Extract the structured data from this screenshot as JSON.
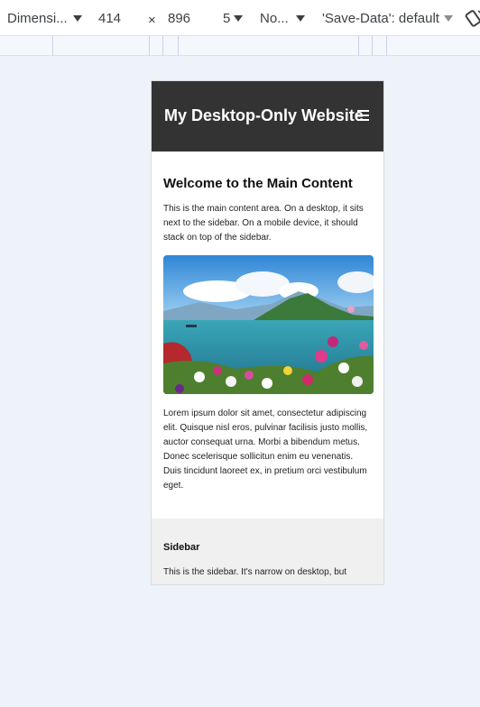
{
  "toolbar": {
    "dimensions_label": "Dimensi...",
    "width_value": "414",
    "times_symbol": "×",
    "height_value": "896",
    "zoom_value": "5",
    "throttle_label": "No...",
    "save_data_label": "'Save-Data': default"
  },
  "site": {
    "title": "My Desktop-Only Website",
    "main": {
      "heading": "Welcome to the Main Content",
      "intro": "This is the main content area. On a desktop, it sits next to the sidebar. On a mobile device, it should stack on top of the sidebar.",
      "body": "Lorem ipsum dolor sit amet, consectetur adipiscing elit. Quisque nisl eros, pulvinar facilisis justo mollis, auctor consequat urna. Morbi a bibendum metus. Donec scelerisque sollicitun enim eu venenatis. Duis tincidunt laoreet ex, in pretium orci vestibulum eget."
    },
    "sidebar": {
      "heading": "Sidebar",
      "text": "This is the sidebar. It's narrow on desktop, but"
    }
  },
  "icons": {
    "dimensions_dropdown": "chevron-down-icon",
    "menu": "hamburger-icon",
    "rotate": "rotate-icon"
  }
}
